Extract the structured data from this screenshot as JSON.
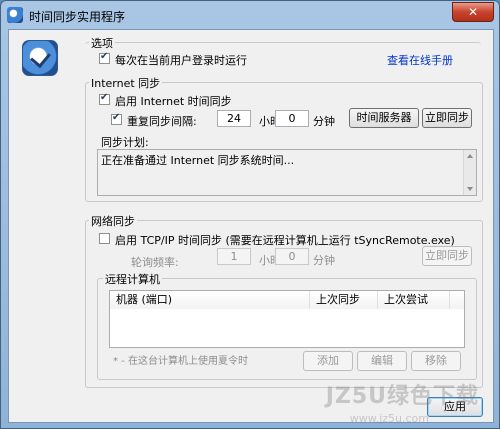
{
  "window": {
    "title": "时间同步实用程序",
    "close_label": "✕"
  },
  "options": {
    "group_title": "选项",
    "run_at_login_label": "每次在当前用户登录时运行",
    "run_at_login_checked": true,
    "online_manual_link": "查看在线手册"
  },
  "internet": {
    "group_title": "Internet 同步",
    "enable_label": "启用 Internet 时间同步",
    "enable_checked": true,
    "repeat_label": "重复同步间隔:",
    "repeat_checked": true,
    "hours_value": "24",
    "hours_unit": "小时",
    "minutes_value": "0",
    "minutes_unit": "分钟",
    "time_servers_button": "时间服务器",
    "sync_now_button": "立即同步",
    "schedule_label": "同步计划:",
    "schedule_text": "正在准备通过 Internet 同步系统时间..."
  },
  "network": {
    "group_title": "网络同步",
    "enable_label": "启用 TCP/IP 时间同步 (需要在远程计算机上运行 tSyncRemote.exe)",
    "enable_checked": false,
    "poll_label": "轮询频率:",
    "hours_value": "1",
    "hours_unit": "小时",
    "minutes_value": "0",
    "minutes_unit": "分钟",
    "sync_now_button": "立即同步",
    "remote_group_title": "远程计算机",
    "table_headers": [
      "机器 (端口)",
      "上次同步",
      "上次尝试"
    ],
    "table_rows": [],
    "hint": "* - 在这台计算机上使用夏令时",
    "add_button": "添加",
    "edit_button": "编辑",
    "remove_button": "移除"
  },
  "footer": {
    "apply_button": "应用"
  },
  "watermark": {
    "logo_text": "JZ5U绿色下载",
    "url_text": "www.jz5u.com"
  },
  "colors": {
    "link": "#0033cc",
    "titlebar": "#a9c7e4",
    "close": "#c8432d"
  }
}
